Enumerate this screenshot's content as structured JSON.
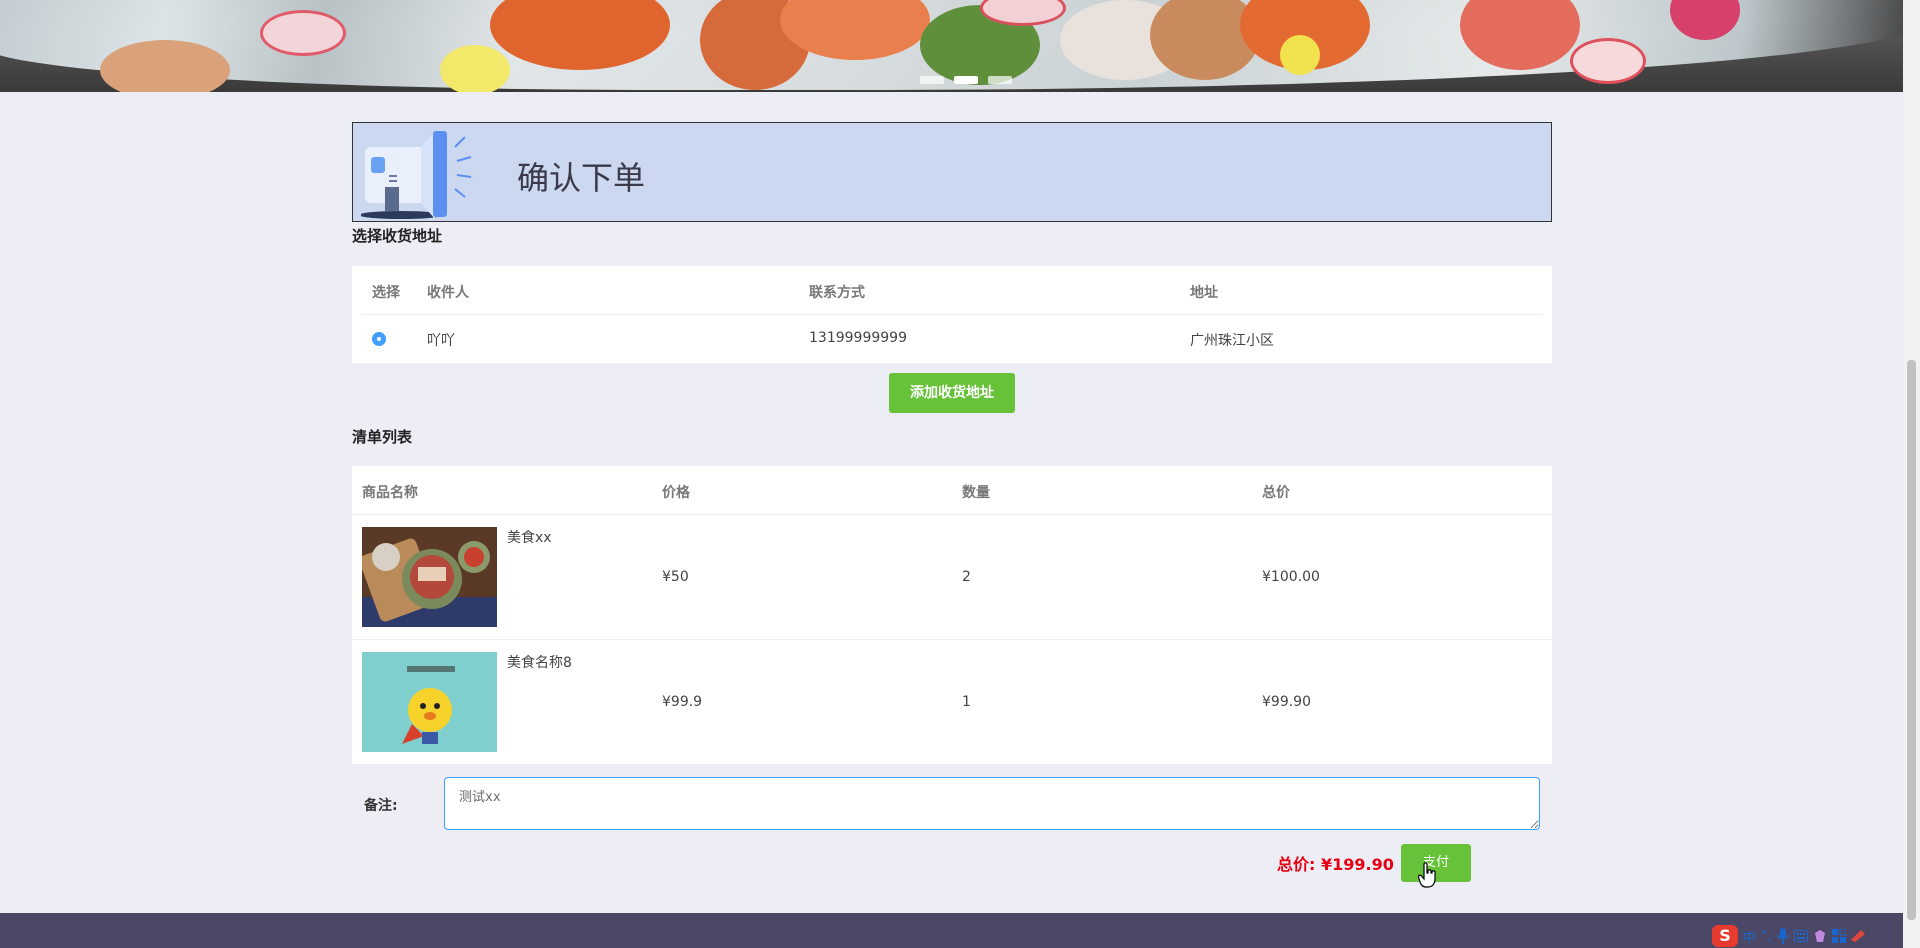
{
  "banner": {
    "name": "banner-image"
  },
  "header": {
    "title": "确认下单"
  },
  "address_section": {
    "title": "选择收货地址",
    "columns": [
      "选择",
      "收件人",
      "联系方式",
      "地址"
    ],
    "rows": [
      {
        "recipient": "吖吖",
        "phone": "13199999999",
        "address": "广州珠江小区",
        "selected": true
      }
    ],
    "add_button": "添加收货地址"
  },
  "order_section": {
    "title": "清单列表",
    "columns": [
      "商品名称",
      "价格",
      "数量",
      "总价"
    ],
    "items": [
      {
        "name": "美食xx",
        "price": "¥50",
        "quantity": "2",
        "subtotal": "¥100.00"
      },
      {
        "name": "美食名称8",
        "price": "¥99.9",
        "quantity": "1",
        "subtotal": "¥99.90"
      }
    ]
  },
  "remark": {
    "label": "备注:",
    "value": "测试xx"
  },
  "summary": {
    "total_label": "总价:",
    "total_value": "¥199.90",
    "pay_button": "支付"
  },
  "taskbar": {
    "ime_logo": "S",
    "ime_mode": "中"
  },
  "colors": {
    "accent_blue": "#409eff",
    "green": "#67c23a",
    "total_red": "#e60012",
    "footer": "#4b4867",
    "header_bg": "#cbd8f0"
  }
}
